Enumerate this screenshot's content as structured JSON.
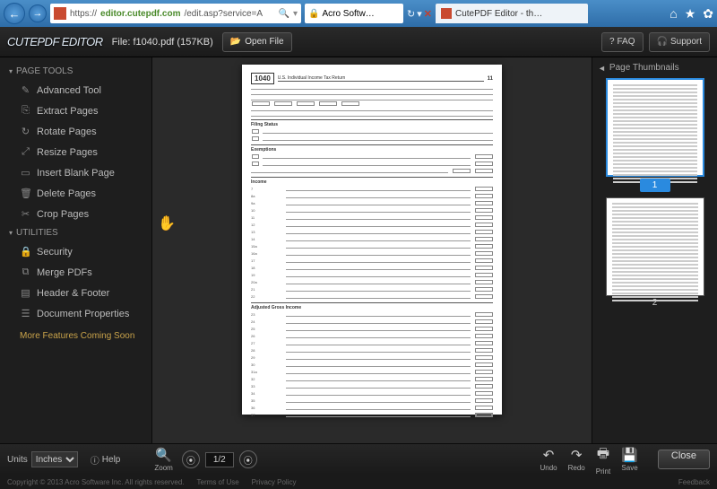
{
  "browser": {
    "url_prefix": "https://",
    "url_host": "editor.cutepdf.com",
    "url_path": "/edit.asp?service=A",
    "search_tab": "Acro Softw…",
    "tab_title": "CutePDF Editor - th…"
  },
  "header": {
    "logo": "CUTEPDF EDITOR",
    "file_label": "File: f1040.pdf (157KB)",
    "open_file": "Open File",
    "faq": "FAQ",
    "support": "Support"
  },
  "sidebar": {
    "section1": "PAGE TOOLS",
    "items1": [
      {
        "icon": "✎",
        "label": "Advanced Tool"
      },
      {
        "icon": "⎘",
        "label": "Extract Pages"
      },
      {
        "icon": "↻",
        "label": "Rotate Pages"
      },
      {
        "icon": "⤢",
        "label": "Resize Pages"
      },
      {
        "icon": "▭",
        "label": "Insert Blank Page"
      },
      {
        "icon": "🗑",
        "label": "Delete Pages"
      },
      {
        "icon": "✂",
        "label": "Crop Pages"
      }
    ],
    "section2": "UTILITIES",
    "items2": [
      {
        "icon": "🔒",
        "label": "Security"
      },
      {
        "icon": "⧉",
        "label": "Merge PDFs"
      },
      {
        "icon": "▤",
        "label": "Header & Footer"
      },
      {
        "icon": "☰",
        "label": "Document Properties"
      }
    ],
    "coming": "More Features Coming Soon"
  },
  "document": {
    "form_number": "1040",
    "form_title": "U.S. Individual Income Tax Return",
    "filing_status": "Filing Status",
    "exemptions": "Exemptions",
    "income": "Income",
    "adjusted": "Adjusted Gross Income"
  },
  "thumbnails": {
    "header": "Page Thumbnails",
    "pages": [
      "1",
      "2"
    ]
  },
  "bottom": {
    "units_label": "Units",
    "units_value": "Inches",
    "help": "Help",
    "zoom": "Zoom",
    "page_current": "1/2",
    "undo": "Undo",
    "redo": "Redo",
    "print": "Print",
    "save": "Save",
    "close": "Close"
  },
  "footer": {
    "copyright": "Copyright © 2013 Acro Software Inc. All rights reserved.",
    "terms": "Terms of Use",
    "privacy": "Privacy Policy",
    "feedback": "Feedback"
  }
}
